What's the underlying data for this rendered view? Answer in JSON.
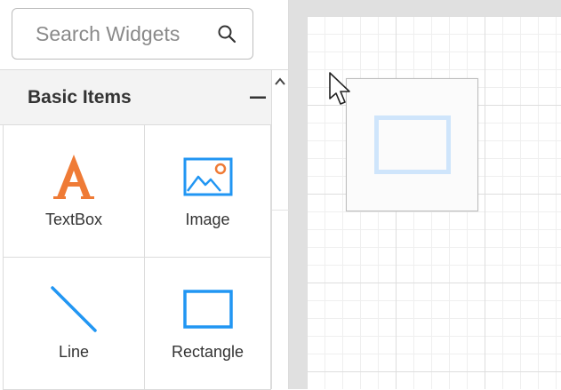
{
  "search": {
    "placeholder": "Search Widgets",
    "value": "",
    "icon": "search-icon"
  },
  "section": {
    "title": "Basic Items",
    "collapse_icon": "minus-icon"
  },
  "widgets": [
    {
      "label": "TextBox",
      "icon": "textbox-icon"
    },
    {
      "label": "Image",
      "icon": "image-icon"
    },
    {
      "label": "Line",
      "icon": "line-icon"
    },
    {
      "label": "Rectangle",
      "icon": "rectangle-icon"
    }
  ],
  "colors": {
    "accent_blue": "#2196f3",
    "textbox_orange": "#ef7b36",
    "preview_blue": "#cfe5fb",
    "canvas_bg": "#e0e0e0"
  },
  "drag_preview": {
    "icon": "rectangle-icon"
  }
}
